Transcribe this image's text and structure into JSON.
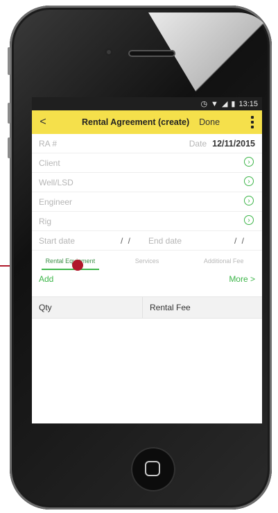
{
  "status_bar": {
    "time": "13:15",
    "icons": [
      "alarm-icon",
      "wifi-icon",
      "signal-icon",
      "battery-icon"
    ]
  },
  "app_bar": {
    "back": "<",
    "title": "Rental Agreement (create)",
    "done": "Done"
  },
  "form": {
    "ra_label": "RA #",
    "date_label": "Date",
    "date_value": "12/11/2015",
    "client": "Client",
    "well": "Well/LSD",
    "engineer": "Engineer",
    "rig": "Rig",
    "start_date": "Start date",
    "start_value": "/ /",
    "end_date": "End date",
    "end_value": "/ /"
  },
  "tabs": [
    "Rental Equipment",
    "Services",
    "Additional Fee"
  ],
  "actions": {
    "add": "Add",
    "more": "More >"
  },
  "table": {
    "headers": [
      "Qty",
      "Rental Fee"
    ]
  },
  "colors": {
    "accent": "#3cb548",
    "appbar": "#f5e04b",
    "annotation": "#b0182a"
  }
}
